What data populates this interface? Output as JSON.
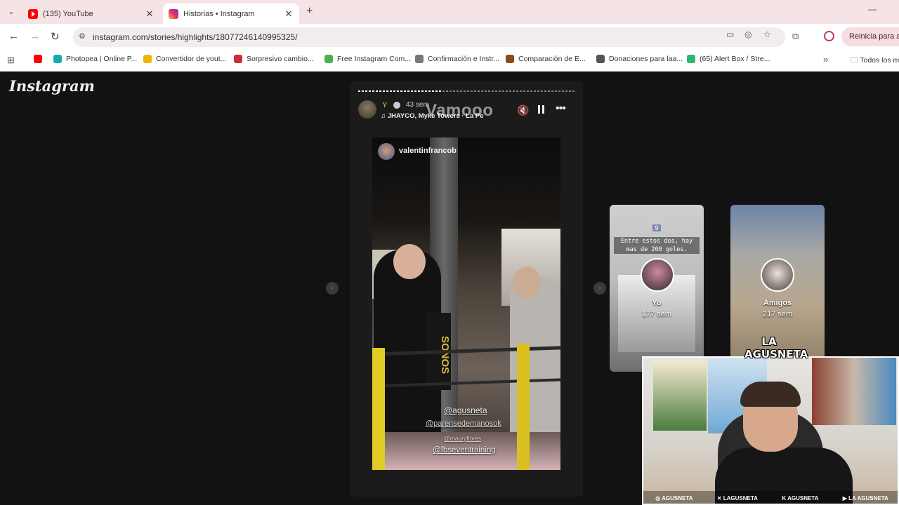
{
  "browser": {
    "tabs": [
      {
        "title": "(135) YouTube",
        "active": false
      },
      {
        "title": "Historias • Instagram",
        "active": true
      }
    ],
    "url": "instagram.com/stories/highlights/18077246140995325/",
    "relaunch_label": "Reinicia para act",
    "bookmarks": [
      {
        "label": "Photopea | Online P...",
        "color": "#19a9b0"
      },
      {
        "label": "Convertidor de yout...",
        "color": "#f0b400"
      },
      {
        "label": "Sorpresivo cambio...",
        "color": "#d02a3a"
      },
      {
        "label": "Free Instagram Com...",
        "color": "#4caf50"
      },
      {
        "label": "Confirmación e Instr...",
        "color": "#777777"
      },
      {
        "label": "Comparación de E...",
        "color": "#8a4a1a"
      },
      {
        "label": "Donaciones para laa...",
        "color": "#555555"
      },
      {
        "label": "(65) Alert Box / Stre...",
        "color": "#2bb673"
      }
    ],
    "bookmarks_folder": "Todos los m"
  },
  "instagram": {
    "logo": "Instagram",
    "story": {
      "time": "43 sem",
      "music": "JHAYCO, Myke Towers · La Pe",
      "caption": "Vamooo",
      "reposted_user": "valentinfrancob",
      "banner_text": "SONOS",
      "mentions": [
        "@agusneta",
        "@parensedemanosok",
        "@mauryflores",
        "@fbseventraining"
      ]
    },
    "highlights": [
      {
        "title": "Yo",
        "time": "177 sem",
        "number": "9",
        "text": "Entre estos dos, hay mas de 200 goles."
      },
      {
        "title": "Amigos",
        "time": "217 sem"
      }
    ]
  },
  "webcam": {
    "logo": "LA AGUSNETA",
    "socials": [
      "AGUSNETA",
      "LAGUSNETA",
      "AGUSNETA",
      "LA AGUSNETA"
    ]
  },
  "colors": {
    "tabbar": "#f6e3e6",
    "page_bg": "#121212",
    "story_bg": "#1b1b1b",
    "ring_yellow": "#e1cb25"
  }
}
